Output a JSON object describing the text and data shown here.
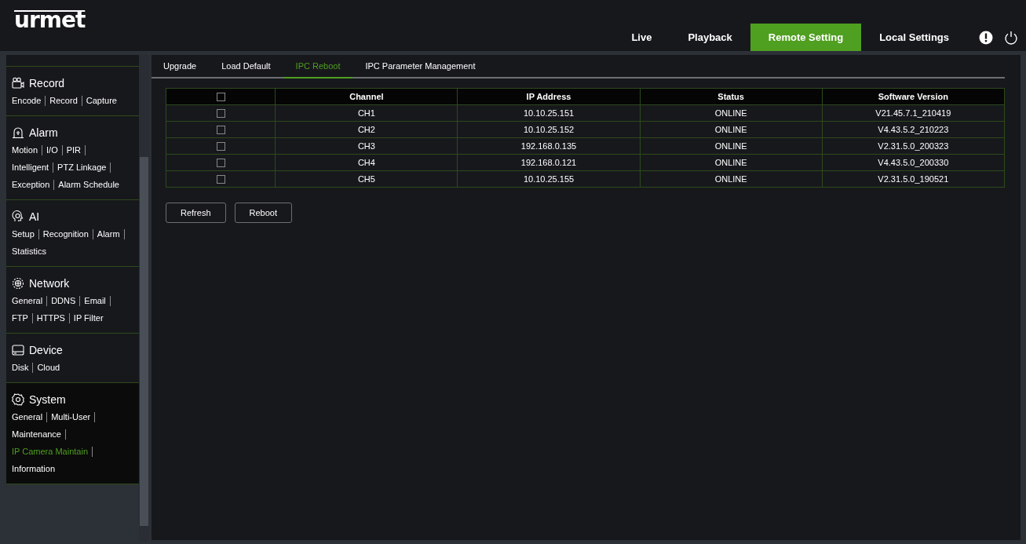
{
  "header": {
    "logo": "urmet",
    "nav": [
      {
        "label": "Live",
        "selected": false
      },
      {
        "label": "Playback",
        "selected": false
      },
      {
        "label": "Remote Setting",
        "selected": true
      },
      {
        "label": "Local Settings",
        "selected": false
      }
    ]
  },
  "sidebar": {
    "sections": [
      {
        "title": "Record",
        "selected": false,
        "links": [
          {
            "label": "Encode",
            "selected": false
          },
          {
            "label": "Record",
            "selected": false
          },
          {
            "label": "Capture",
            "selected": false
          }
        ]
      },
      {
        "title": "Alarm",
        "selected": false,
        "links": [
          {
            "label": "Motion",
            "selected": false
          },
          {
            "label": "I/O",
            "selected": false
          },
          {
            "label": "PIR",
            "selected": false
          },
          {
            "label": "Intelligent",
            "selected": false
          },
          {
            "label": "PTZ Linkage",
            "selected": false
          },
          {
            "label": "Exception",
            "selected": false
          },
          {
            "label": "Alarm Schedule",
            "selected": false
          }
        ]
      },
      {
        "title": "AI",
        "selected": false,
        "links": [
          {
            "label": "Setup",
            "selected": false
          },
          {
            "label": "Recognition",
            "selected": false
          },
          {
            "label": "Alarm",
            "selected": false
          },
          {
            "label": "Statistics",
            "selected": false
          }
        ]
      },
      {
        "title": "Network",
        "selected": false,
        "links": [
          {
            "label": "General",
            "selected": false
          },
          {
            "label": "DDNS",
            "selected": false
          },
          {
            "label": "Email",
            "selected": false
          },
          {
            "label": "FTP",
            "selected": false
          },
          {
            "label": "HTTPS",
            "selected": false
          },
          {
            "label": "IP Filter",
            "selected": false
          }
        ]
      },
      {
        "title": "Device",
        "selected": false,
        "links": [
          {
            "label": "Disk",
            "selected": false
          },
          {
            "label": "Cloud",
            "selected": false
          }
        ]
      },
      {
        "title": "System",
        "selected": true,
        "links": [
          {
            "label": "General",
            "selected": false
          },
          {
            "label": "Multi-User",
            "selected": false
          },
          {
            "label": "Maintenance",
            "selected": false
          },
          {
            "label": "IP Camera Maintain",
            "selected": true
          },
          {
            "label": "Information",
            "selected": false
          }
        ]
      }
    ]
  },
  "tabs": [
    {
      "label": "Upgrade",
      "selected": false
    },
    {
      "label": "Load Default",
      "selected": false
    },
    {
      "label": "IPC Reboot",
      "selected": true
    },
    {
      "label": "IPC Parameter Management",
      "selected": false
    }
  ],
  "table": {
    "select_all_checked": false,
    "columns": [
      "Channel",
      "IP Address",
      "Status",
      "Software Version"
    ],
    "rows": [
      {
        "checked": false,
        "cells": [
          "CH1",
          "10.10.25.151",
          "ONLINE",
          "V21.45.7.1_210419"
        ]
      },
      {
        "checked": false,
        "cells": [
          "CH2",
          "10.10.25.152",
          "ONLINE",
          "V4.43.5.2_210223"
        ]
      },
      {
        "checked": false,
        "cells": [
          "CH3",
          "192.168.0.135",
          "ONLINE",
          "V2.31.5.0_200323"
        ]
      },
      {
        "checked": false,
        "cells": [
          "CH4",
          "192.168.0.121",
          "ONLINE",
          "V4.43.5.0_200330"
        ]
      },
      {
        "checked": false,
        "cells": [
          "CH5",
          "10.10.25.155",
          "ONLINE",
          "V2.31.5.0_190521"
        ]
      }
    ]
  },
  "buttons": [
    "Refresh",
    "Reboot"
  ]
}
